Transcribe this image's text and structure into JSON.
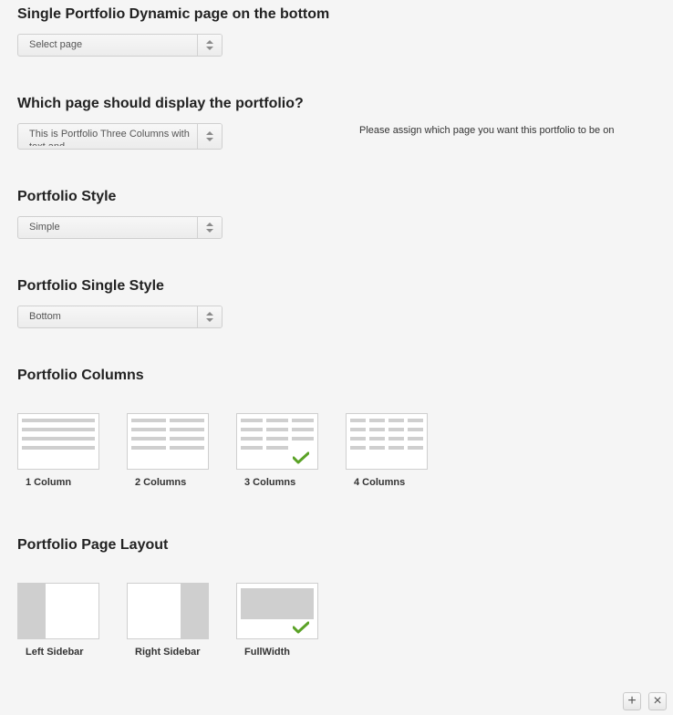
{
  "dynamic_page": {
    "title": "Single Portfolio Dynamic page on the bottom",
    "value": "Select page"
  },
  "display_page": {
    "title": "Which page should display the portfolio?",
    "value": "This is Portfolio Three Columns with text and",
    "help": "Please assign which page you want this portfolio to be on"
  },
  "portfolio_style": {
    "title": "Portfolio Style",
    "value": "Simple"
  },
  "single_style": {
    "title": "Portfolio Single Style",
    "value": "Bottom"
  },
  "columns": {
    "title": "Portfolio Columns",
    "selected": "3 Columns",
    "options": [
      {
        "label": "1 Column"
      },
      {
        "label": "2 Columns"
      },
      {
        "label": "3 Columns"
      },
      {
        "label": "4 Columns"
      }
    ]
  },
  "layout": {
    "title": "Portfolio Page Layout",
    "selected": "FullWidth",
    "options": [
      {
        "label": "Left Sidebar"
      },
      {
        "label": "Right Sidebar"
      },
      {
        "label": "FullWidth"
      }
    ]
  },
  "icons": {
    "check": "checkmark-icon",
    "add": "plus-icon",
    "remove": "close-icon",
    "add_glyph": "+",
    "remove_glyph": "×"
  },
  "colors": {
    "check": "#5aa226",
    "background": "#f5f5f5",
    "placeholder_gray": "#cfcfcf"
  }
}
